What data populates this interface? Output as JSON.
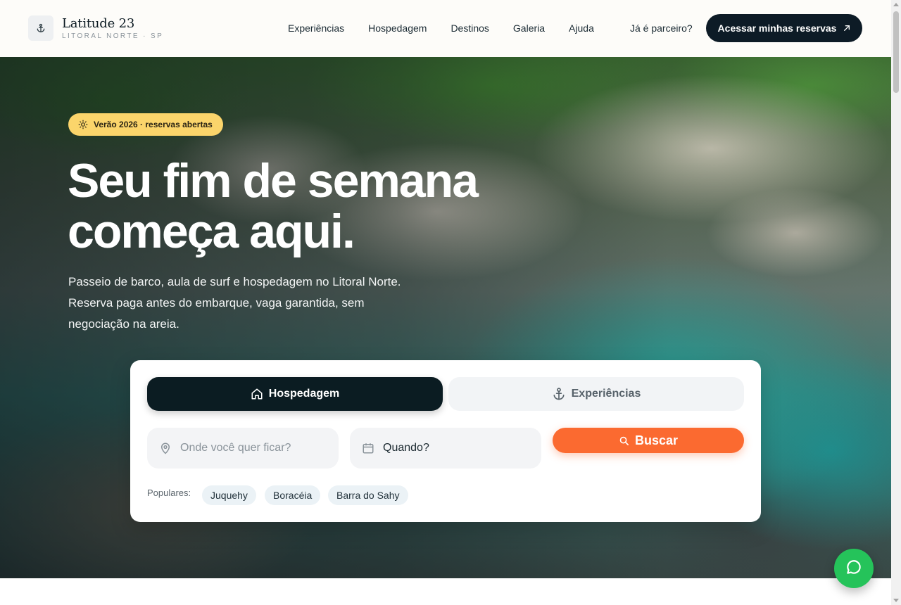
{
  "brand": {
    "name": "Latitude 23",
    "tagline": "LITORAL NORTE · SP",
    "icon": "anchor-icon"
  },
  "nav": {
    "items": [
      {
        "label": "Experiências"
      },
      {
        "label": "Hospedagem"
      },
      {
        "label": "Destinos"
      },
      {
        "label": "Galeria"
      },
      {
        "label": "Ajuda"
      }
    ],
    "partner_label": "Já é parceiro?",
    "cta_label": "Acessar minhas reservas",
    "cta_icon": "arrow-up-right-icon"
  },
  "hero": {
    "badge": "Verão 2026 · reservas abertas",
    "badge_icon": "sun-icon",
    "title_line1": "Seu fim de semana",
    "title_line2": "começa aqui.",
    "subtitle": "Passeio de barco, aula de surf e hospedagem no Litoral Norte. Reserva paga antes do embarque, vaga garantida, sem negociação na areia."
  },
  "search": {
    "tabs": [
      {
        "label": "Hospedagem",
        "icon": "home-icon",
        "active": true
      },
      {
        "label": "Experiências",
        "icon": "anchor-icon",
        "active": false
      }
    ],
    "where_placeholder": "Onde você quer ficar?",
    "when_value": "Quando?",
    "button_label": "Buscar",
    "popular_label": "Populares:",
    "popular": [
      "Juquehy",
      "Boracéia",
      "Barra do Sahy"
    ]
  },
  "floating": {
    "icon": "whatsapp-icon"
  },
  "colors": {
    "primary_dark": "#0b1c22",
    "accent_orange": "#fb6a30",
    "badge_yellow": "#fbd56b",
    "chip_bg": "#ebf2f6",
    "whatsapp_green": "#25c35a"
  }
}
